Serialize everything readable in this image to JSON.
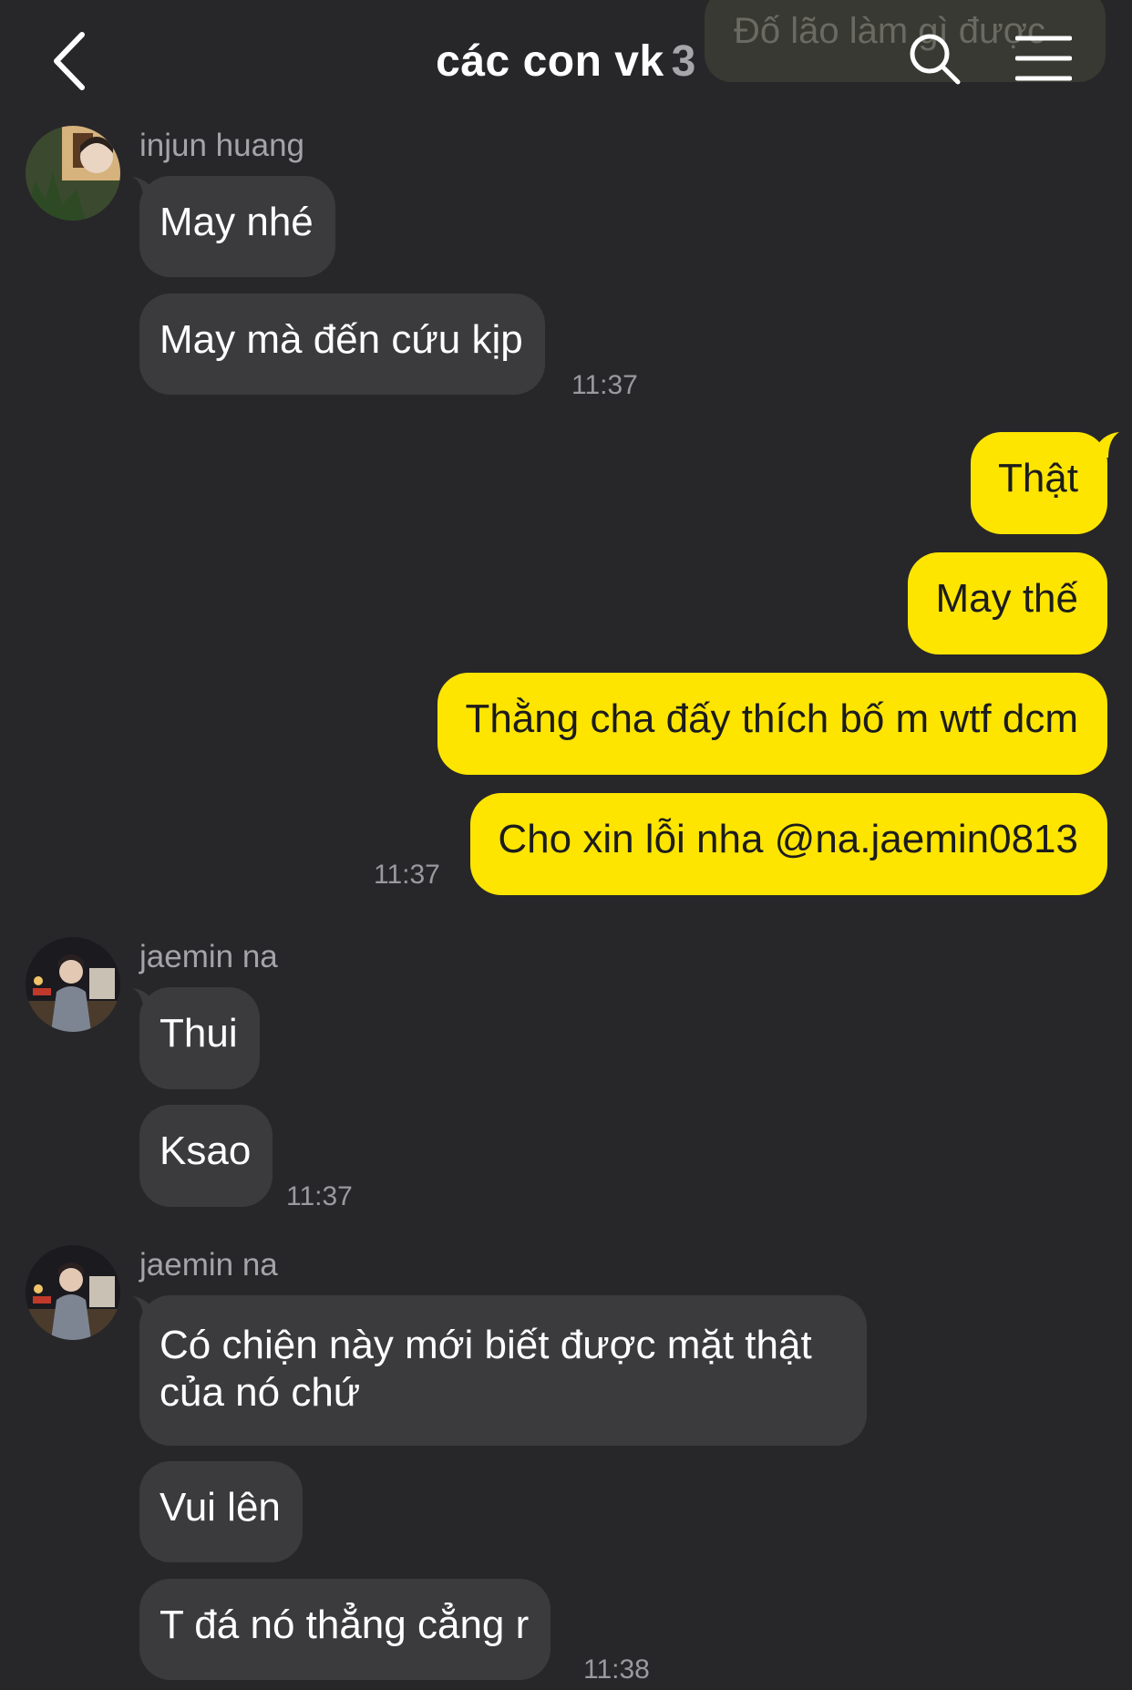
{
  "header": {
    "title": "các con vk",
    "member_count": "3",
    "pinned_notice": "Đố lão làm gì được",
    "back_icon": "chevron-left-icon",
    "search_icon": "search-icon",
    "menu_icon": "hamburger-menu-icon"
  },
  "colors": {
    "background": "#27272a",
    "incoming_bubble": "#3b3b3e",
    "outgoing_bubble": "#fee500",
    "sender_name": "#a4a4a8",
    "timestamp": "#9a9a9e"
  },
  "messages": {
    "group1": {
      "sender": "injun huang",
      "texts": [
        "May nhé",
        "May mà đến cứu kịp"
      ],
      "time": "11:37"
    },
    "group2": {
      "sender": "me",
      "texts": [
        "Thật",
        "May thế",
        "Thằng cha đấy thích bố m wtf dcm",
        "Cho xin lỗi nha @na.jaemin0813"
      ],
      "time": "11:37"
    },
    "group3": {
      "sender": "jaemin na",
      "texts": [
        "Thui",
        "Ksao"
      ],
      "time": "11:37"
    },
    "group4": {
      "sender": "jaemin na",
      "texts": [
        "Có chiện này mới biết được mặt thật của nó chứ",
        "Vui lên",
        "T đá nó thẳng cẳng r"
      ],
      "time": "11:38"
    }
  }
}
